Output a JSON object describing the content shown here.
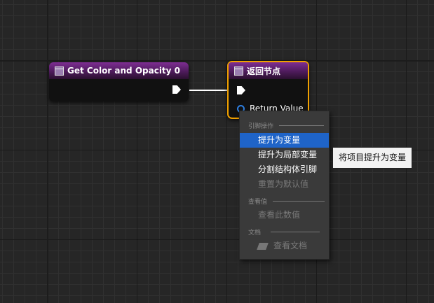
{
  "nodes": {
    "get_color": {
      "title": "Get Color and Opacity 0"
    },
    "return_node": {
      "title": "返回节点",
      "pin_label": "Return Value",
      "selected_color": "#f0a000"
    }
  },
  "context_menu": {
    "section_pin": "引脚操作",
    "promote_variable": "提升为变量",
    "promote_local": "提升为局部变量",
    "split_struct": "分割结构体引脚",
    "reset_default": "重置为默认值",
    "section_watch": "查看值",
    "watch_value": "查看此数值",
    "section_docs": "文档",
    "view_docs": "查看文档"
  },
  "tooltip": {
    "text": "将项目提升为变量"
  },
  "colors": {
    "menu_highlight": "#1f64c8",
    "node_header": "#7e2d93",
    "pin_blue": "#2f7fe0"
  }
}
